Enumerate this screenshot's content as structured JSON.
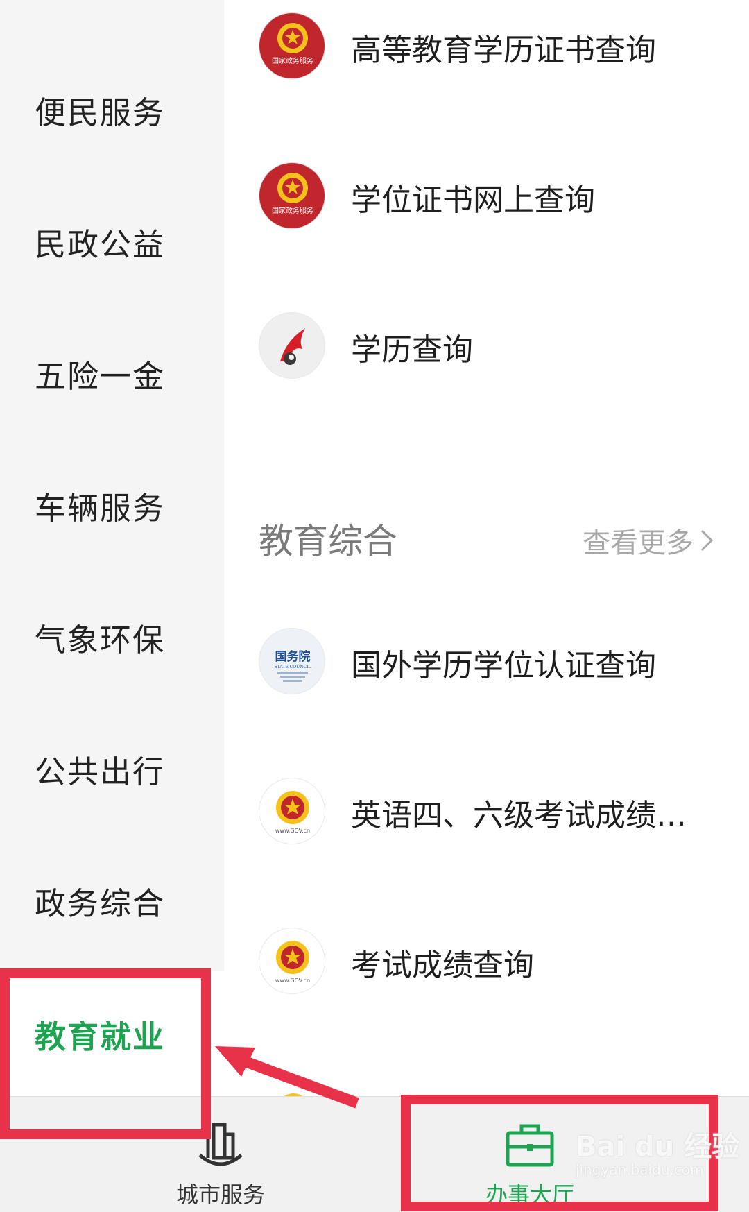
{
  "sidebar": {
    "items": [
      {
        "label": "便民服务"
      },
      {
        "label": "民政公益"
      },
      {
        "label": "五险一金"
      },
      {
        "label": "车辆服务"
      },
      {
        "label": "气象环保"
      },
      {
        "label": "公共出行"
      },
      {
        "label": "政务综合"
      },
      {
        "label": "教育就业",
        "active": true
      }
    ]
  },
  "top_services": [
    {
      "label": "高等教育学历证书查询",
      "icon": "national-emblem-gov-service-icon",
      "icon_text": "国家政务服务"
    },
    {
      "label": "学位证书网上查询",
      "icon": "national-emblem-gov-service-icon",
      "icon_text": "国家政务服务"
    },
    {
      "label": "学历查询",
      "icon": "red-bird-logo-icon"
    }
  ],
  "section": {
    "title": "教育综合",
    "more_label": "查看更多"
  },
  "section_services": [
    {
      "label": "国外学历学位认证查询",
      "icon": "state-council-logo-icon",
      "icon_text": "国务院",
      "icon_subtext": "STATE COUNCIL"
    },
    {
      "label": "英语四、六级考试成绩…",
      "icon": "gov-cn-emblem-icon",
      "icon_text": "www.GOV.cn"
    },
    {
      "label": "考试成绩查询",
      "icon": "gov-cn-emblem-icon",
      "icon_text": "www.GOV.cn"
    }
  ],
  "tabbar": {
    "city_label": "城市服务",
    "hall_label": "办事大厅"
  },
  "watermark": {
    "brand": "Bai du 经验",
    "url": "jingyan.baidu.com"
  },
  "colors": {
    "accent_green": "#1fa352",
    "highlight_red": "#e8324a",
    "emblem_red": "#c0272d",
    "emblem_gold": "#f4c21b"
  }
}
